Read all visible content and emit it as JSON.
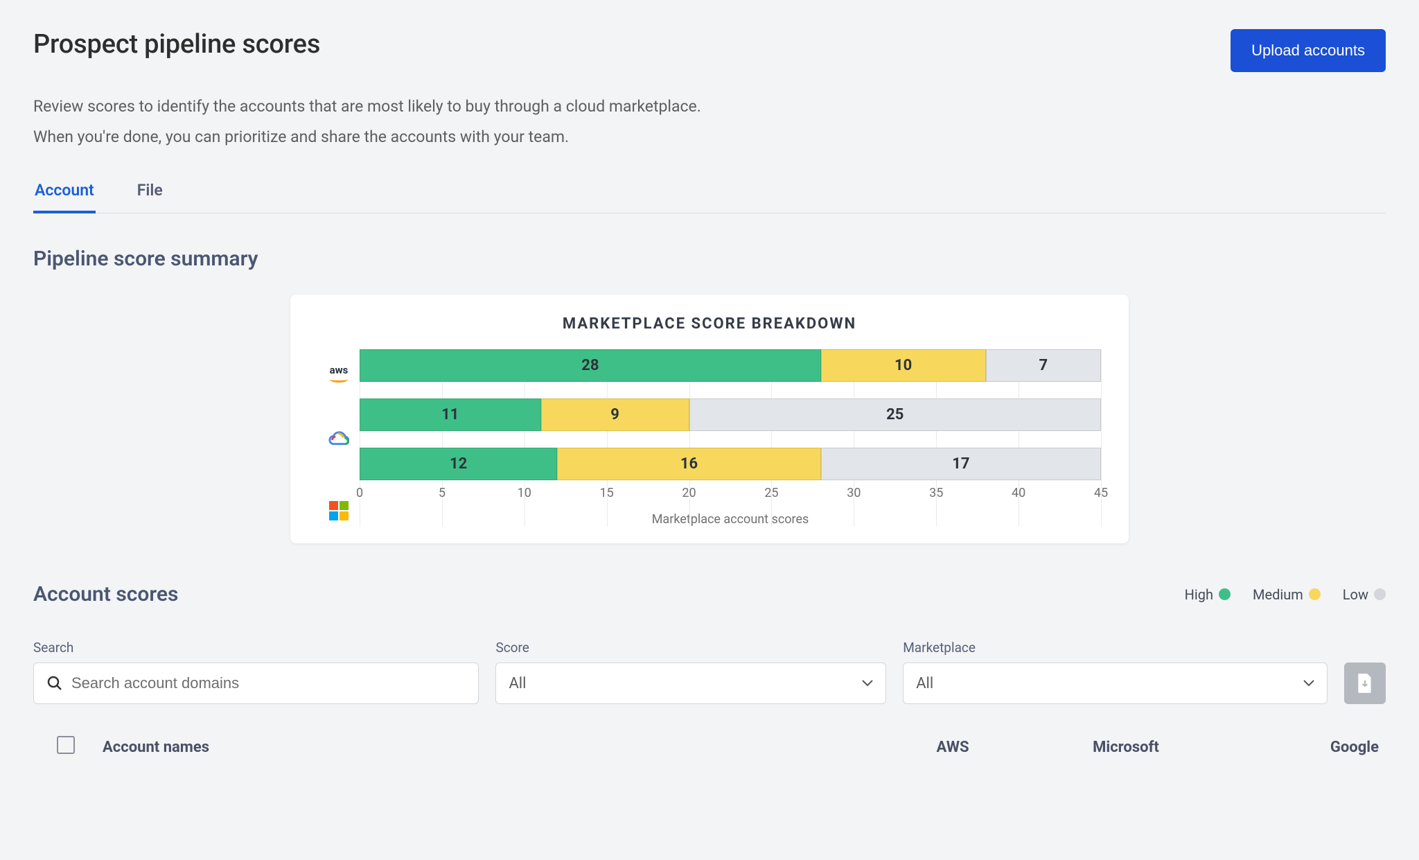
{
  "header": {
    "title": "Prospect pipeline scores",
    "upload_label": "Upload accounts",
    "desc_line1": "Review scores to identify the accounts that are most likely to buy through a cloud marketplace.",
    "desc_line2": "When you're done, you can prioritize and share the accounts with your team."
  },
  "tabs": {
    "account": "Account",
    "file": "File"
  },
  "summary": {
    "section_title": "Pipeline score summary",
    "chart_title": "MARKETPLACE SCORE BREAKDOWN",
    "xlabel": "Marketplace account scores"
  },
  "scores_section": {
    "title": "Account scores",
    "legend": {
      "high": "High",
      "medium": "Medium",
      "low": "Low"
    }
  },
  "filters": {
    "search_label": "Search",
    "search_placeholder": "Search account domains",
    "score_label": "Score",
    "score_value": "All",
    "marketplace_label": "Marketplace",
    "marketplace_value": "All"
  },
  "table": {
    "col_name": "Account names",
    "col_aws": "AWS",
    "col_ms": "Microsoft",
    "col_google": "Google"
  },
  "chart_data": {
    "type": "bar",
    "stacked": true,
    "orientation": "horizontal",
    "title": "MARKETPLACE SCORE BREAKDOWN",
    "xlabel": "Marketplace account scores",
    "ylabel": "",
    "xlim": [
      0,
      45
    ],
    "xticks": [
      0,
      5,
      10,
      15,
      20,
      25,
      30,
      35,
      40,
      45
    ],
    "categories": [
      "aws",
      "google-cloud",
      "microsoft"
    ],
    "series": [
      {
        "name": "High",
        "color": "#3fbf88",
        "values": [
          28,
          11,
          12
        ]
      },
      {
        "name": "Medium",
        "color": "#f7d85d",
        "values": [
          10,
          9,
          16
        ]
      },
      {
        "name": "Low",
        "color": "#e2e5e9",
        "values": [
          7,
          25,
          17
        ]
      }
    ]
  }
}
